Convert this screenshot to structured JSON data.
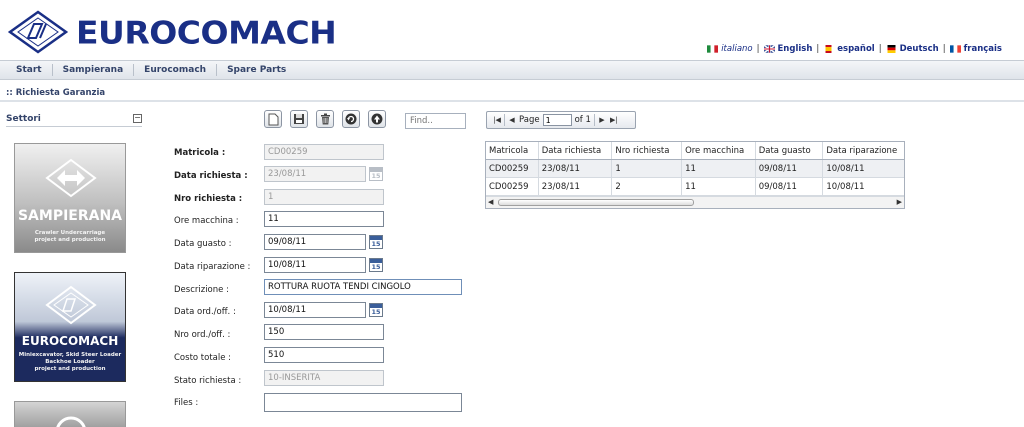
{
  "brand": {
    "name": "EUROCOMACH",
    "color": "#1a2f86"
  },
  "languages": [
    {
      "label": "italiano",
      "active": true
    },
    {
      "label": "English",
      "active": false
    },
    {
      "label": "español",
      "active": false
    },
    {
      "label": "Deutsch",
      "active": false
    },
    {
      "label": "français",
      "active": false
    }
  ],
  "nav": [
    "Start",
    "Sampierana",
    "Eurocomach",
    "Spare Parts"
  ],
  "breadcrumb": ":: Richiesta Garanzia",
  "sidebar": {
    "title": "Settori",
    "collapse_label": "⊟",
    "cards": [
      {
        "name": "SAMPIERANA",
        "sub1": "Crawler Undercarriage",
        "sub2": "project and production"
      },
      {
        "name": "EUROCOMACH",
        "sub1": "Miniexcavator, Skid Steer Loader",
        "sub2": "Backhoe Loader",
        "sub3": "project and production"
      }
    ]
  },
  "toolbar": {
    "find_placeholder": "Find.."
  },
  "form": {
    "matricola": {
      "label": "Matricola :",
      "value": "CD00259"
    },
    "data_richiesta": {
      "label": "Data richiesta :",
      "value": "23/08/11"
    },
    "nro_richiesta": {
      "label": "Nro richiesta :",
      "value": "1"
    },
    "ore_macchina": {
      "label": "Ore macchina :",
      "value": "11"
    },
    "data_guasto": {
      "label": "Data guasto :",
      "value": "09/08/11"
    },
    "data_riparazione": {
      "label": "Data riparazione :",
      "value": "10/08/11"
    },
    "descrizione": {
      "label": "Descrizione :",
      "value": "ROTTURA RUOTA TENDI CINGOLO"
    },
    "data_ord": {
      "label": "Data ord./off. :",
      "value": "10/08/11"
    },
    "nro_ord": {
      "label": "Nro ord./off. :",
      "value": "150"
    },
    "costo_totale": {
      "label": "Costo totale :",
      "value": "510"
    },
    "stato_richiesta": {
      "label": "Stato richiesta :",
      "value": "10-INSERITA"
    },
    "files": {
      "label": "Files :",
      "value": ""
    },
    "calendar_day": "15"
  },
  "pager": {
    "page_label": "Page",
    "page_value": "1",
    "of_label": "of 1"
  },
  "grid": {
    "columns": [
      "Matricola",
      "Data richiesta",
      "Nro richiesta",
      "Ore macchina",
      "Data guasto",
      "Data riparazione"
    ],
    "rows": [
      [
        "CD00259",
        "23/08/11",
        "1",
        "11",
        "09/08/11",
        "10/08/11"
      ],
      [
        "CD00259",
        "23/08/11",
        "2",
        "11",
        "09/08/11",
        "10/08/11"
      ]
    ]
  }
}
